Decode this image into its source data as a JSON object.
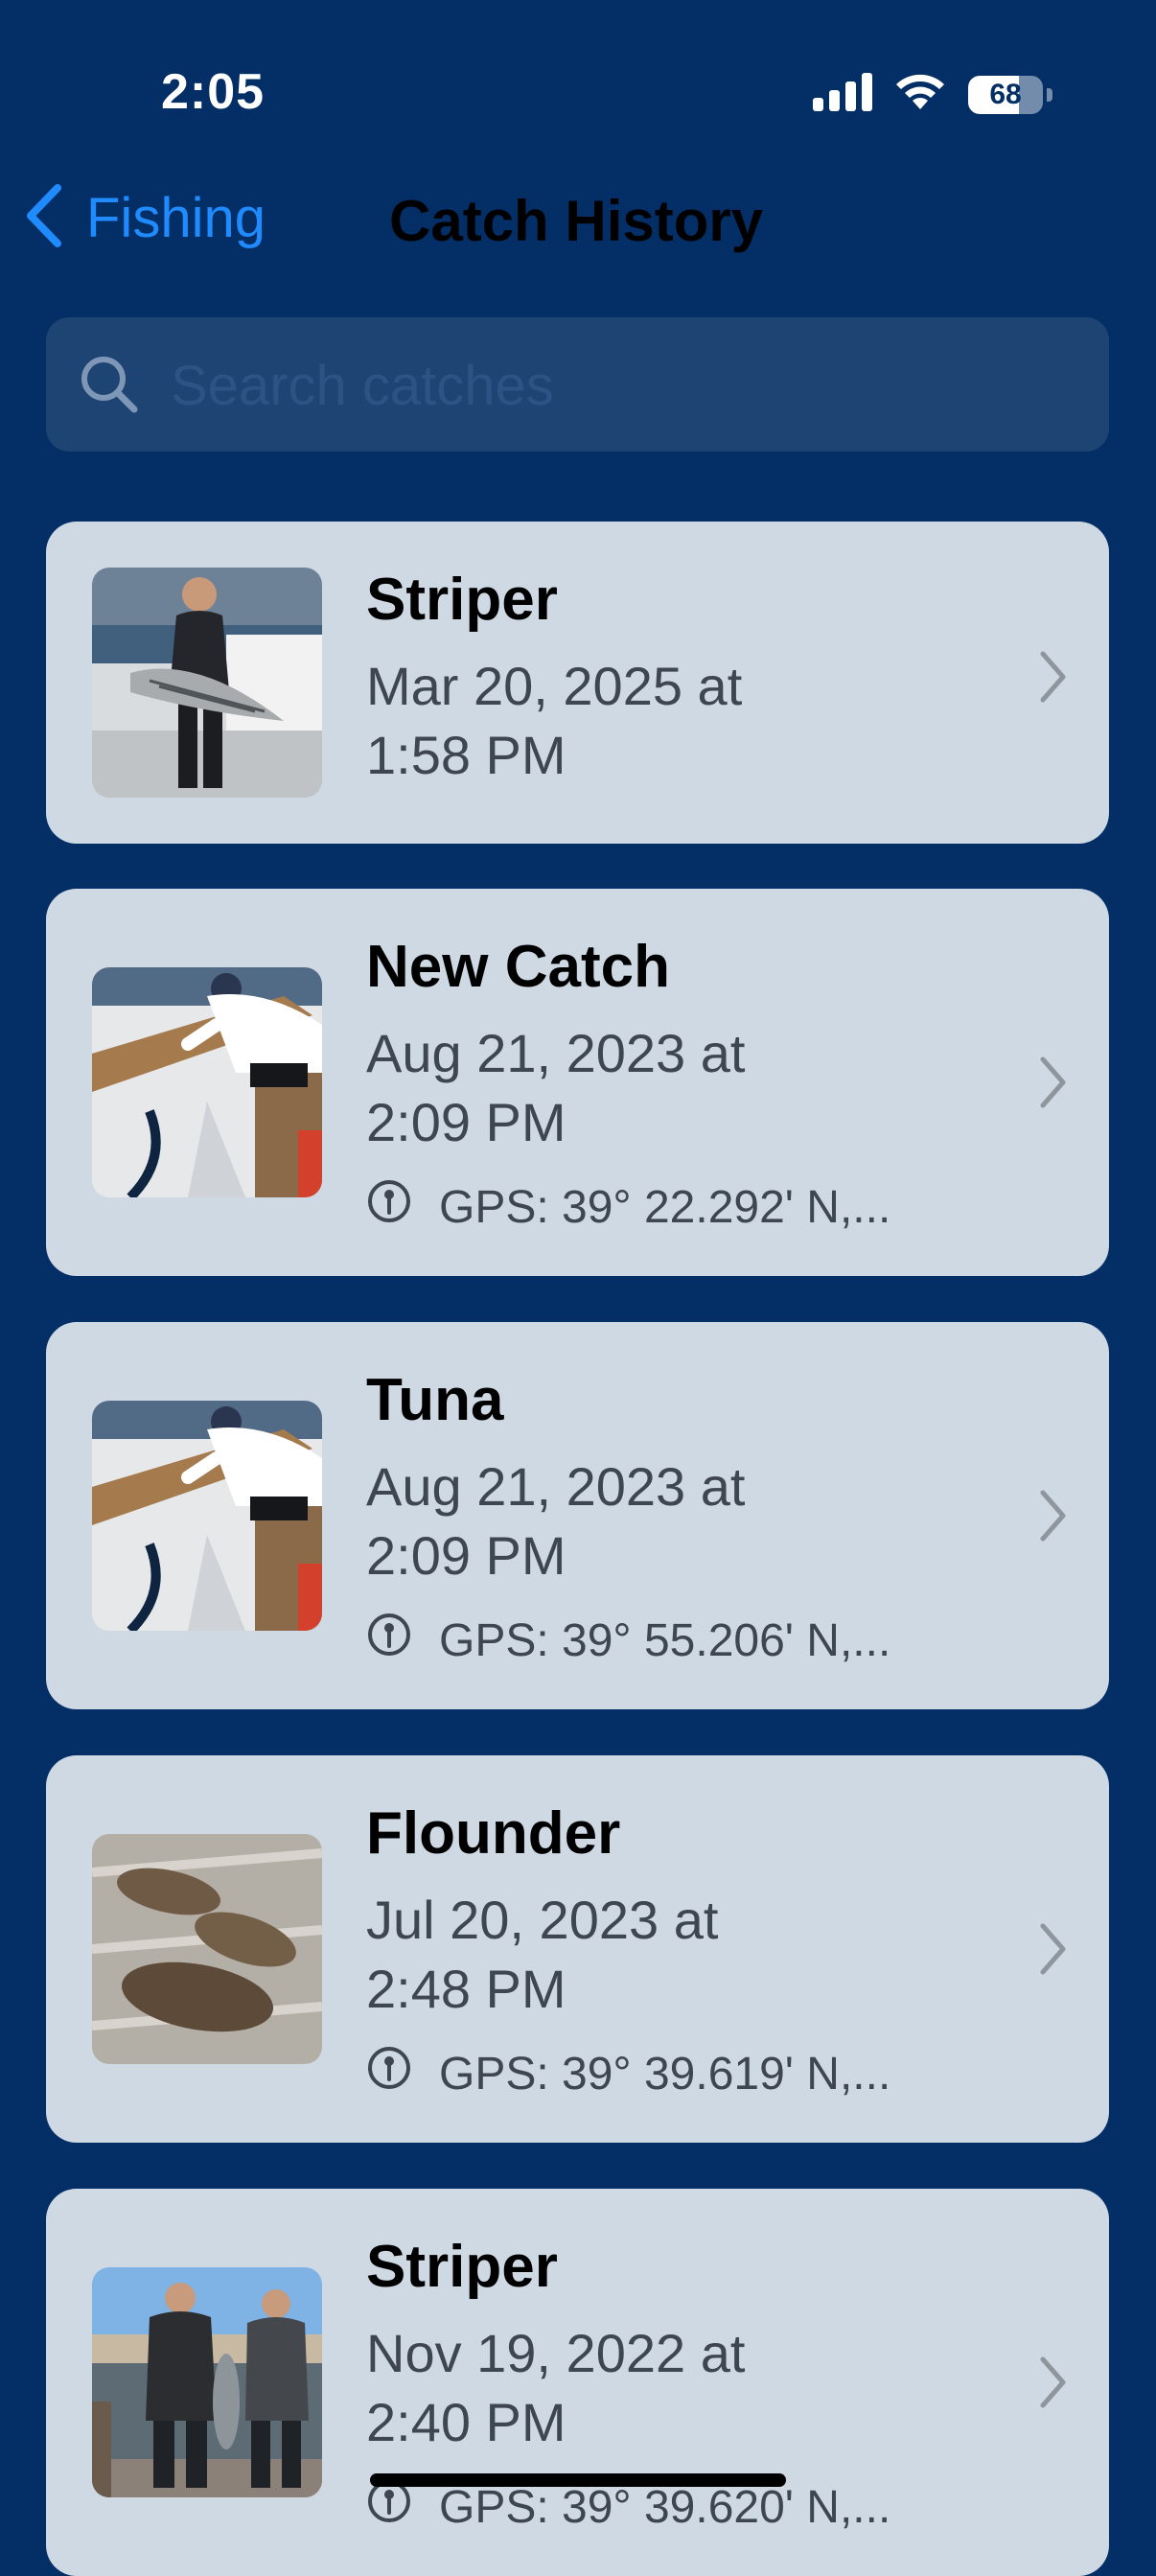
{
  "status_bar": {
    "time": "2:05",
    "battery": "68",
    "battery_level": 0.68
  },
  "nav": {
    "back_label": "Fishing",
    "title": "Catch History"
  },
  "search": {
    "placeholder": "Search catches",
    "value": ""
  },
  "catches": [
    {
      "species": "Striper",
      "date_line1": "Mar 20, 2025 at",
      "date_line2": "1:58 PM",
      "gps": ""
    },
    {
      "species": "New Catch",
      "date_line1": "Aug 21, 2023 at",
      "date_line2": "2:09 PM",
      "gps": "GPS: 39° 22.292' N,..."
    },
    {
      "species": "Tuna",
      "date_line1": "Aug 21, 2023 at",
      "date_line2": "2:09 PM",
      "gps": "GPS: 39° 55.206' N,..."
    },
    {
      "species": "Flounder",
      "date_line1": "Jul 20, 2023 at",
      "date_line2": "2:48 PM",
      "gps": "GPS: 39° 39.619' N,..."
    },
    {
      "species": "Striper",
      "date_line1": "Nov 19, 2022 at",
      "date_line2": "2:40 PM",
      "gps": "GPS: 39° 39.620' N,..."
    }
  ],
  "colors": {
    "background": "#032f66",
    "accent": "#1f8bff",
    "card": "#cfd9e3",
    "search_field": "#1e4473"
  }
}
